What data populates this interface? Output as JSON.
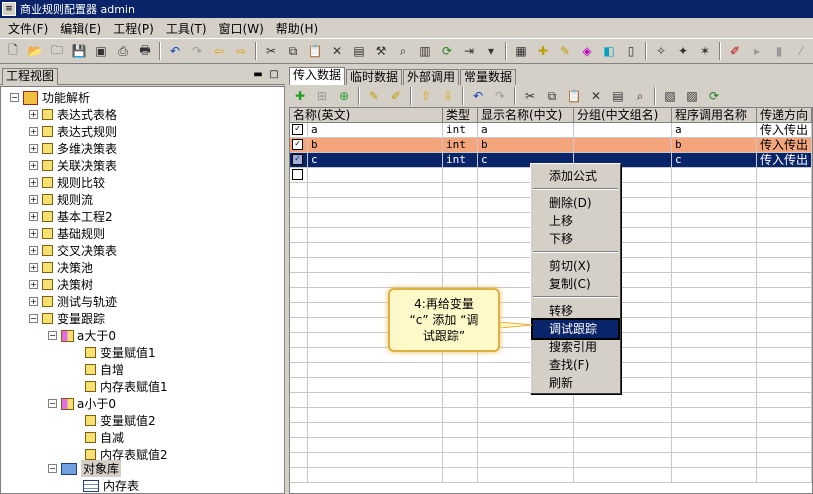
{
  "window": {
    "title": "商业规则配置器 admin",
    "icon_label": "≡"
  },
  "menu": [
    "文件(F)",
    "编辑(E)",
    "工程(P)",
    "工具(T)",
    "窗口(W)",
    "帮助(H)"
  ],
  "left_pane": {
    "tab": "工程视图",
    "tree": {
      "root": "功能解析",
      "items": [
        "表达式表格",
        "表达式规则",
        "多维决策表",
        "关联决策表",
        "规则比较",
        "规则流",
        "基本工程2",
        "基础规则",
        "交叉决策表",
        "决策池",
        "决策树",
        "测试与轨迹",
        "变量跟踪"
      ],
      "cond1": "a大于0",
      "cond1_children": [
        "变量赋值1",
        "自增",
        "内存表赋值1"
      ],
      "cond2": "a小于0",
      "cond2_children": [
        "变量赋值2",
        "自减",
        "内存表赋值2"
      ],
      "object_lib": "对象库",
      "memory_table": "内存表"
    }
  },
  "right_pane": {
    "tabs": [
      "传入数据",
      "临时数据",
      "外部调用",
      "常量数据"
    ],
    "columns": [
      "名称(英文)",
      "类型",
      "显示名称(中文)",
      "分组(中文组名)",
      "程序调用名称",
      "传递方向"
    ],
    "rows": [
      {
        "name": "a",
        "type": "int",
        "display": "a",
        "group": "",
        "call": "a",
        "direction": "传入传出",
        "checked": "✓"
      },
      {
        "name": "b",
        "type": "int",
        "display": "b",
        "group": "",
        "call": "b",
        "direction": "传入传出",
        "checked": "✓"
      },
      {
        "name": "c",
        "type": "int",
        "display": "c",
        "group": "",
        "call": "c",
        "direction": "传入传出",
        "checked": "✓"
      }
    ]
  },
  "context_menu": {
    "add_formula": "添加公式",
    "delete": "删除(D)",
    "move_up": "上移",
    "move_down": "下移",
    "cut": "剪切(X)",
    "copy": "复制(C)",
    "transfer": "转移",
    "debug_trace": "调试跟踪",
    "search_ref": "搜索引用",
    "find": "查找(F)",
    "refresh": "刷新"
  },
  "callout": {
    "line1": "4:再给变量",
    "line2": "“c” 添加 “调",
    "line3": "试跟踪”"
  },
  "colors": {
    "title_bg": "#0a246a",
    "row_b": "#f4a57c",
    "row_selected": "#0a246a",
    "callout_border": "#e0b040"
  },
  "icons": {
    "main_toolbar": [
      "new-icon",
      "open-icon",
      "folder-icon",
      "save-icon",
      "save-all-icon",
      "print-preview-icon",
      "print-icon",
      "undo-icon",
      "redo-icon",
      "back-icon",
      "forward-icon",
      "cut-icon",
      "copy-icon",
      "paste-icon",
      "delete-icon",
      "properties-icon",
      "tools-icon",
      "find-icon",
      "chart-icon",
      "refresh-icon",
      "indent-icon",
      "settings-icon",
      "project-icon",
      "add-icon",
      "edit-icon",
      "module-icon",
      "library-icon",
      "help-icon",
      "wizard-icon",
      "tips-icon",
      "check-icon",
      "run-icon",
      "stop-icon",
      "close-icon"
    ]
  }
}
